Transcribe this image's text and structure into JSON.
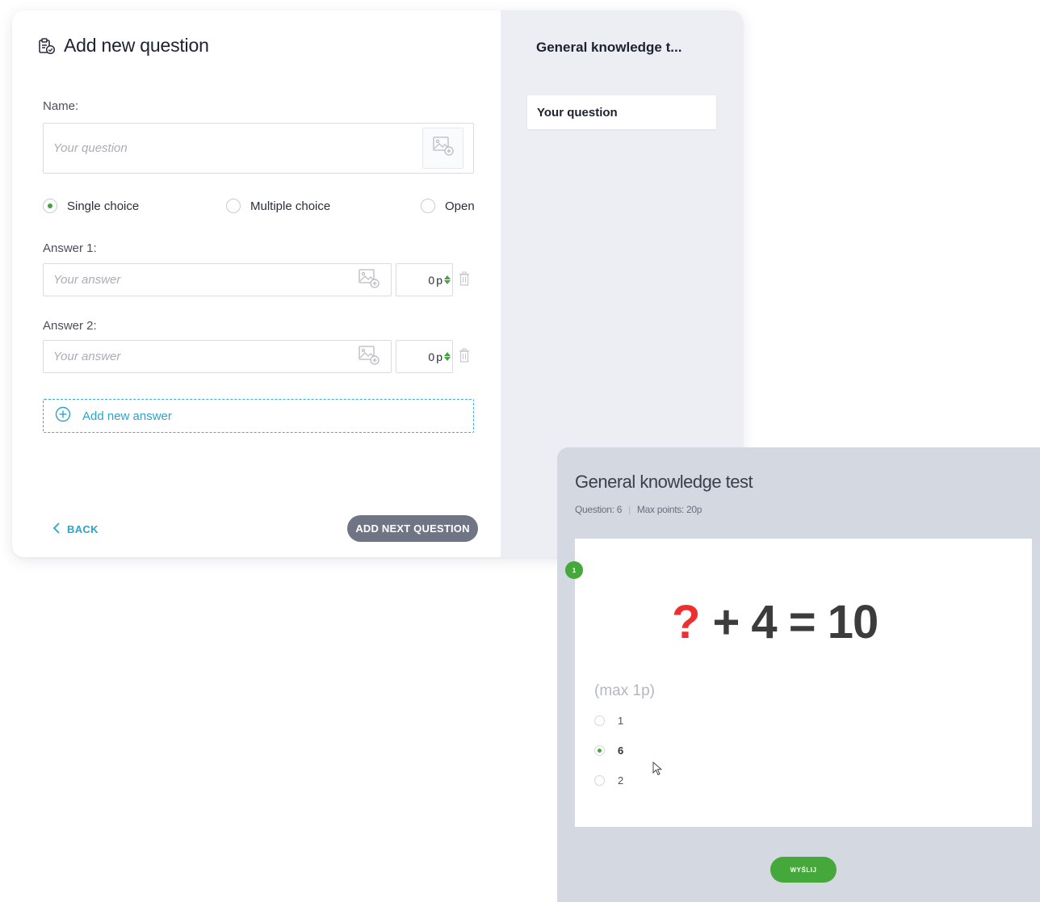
{
  "editor": {
    "title": "Add new question",
    "name_label": "Name:",
    "question_placeholder": "Your question",
    "question_types": [
      {
        "label": "Single choice",
        "selected": true
      },
      {
        "label": "Multiple choice",
        "selected": false
      },
      {
        "label": "Open",
        "selected": false
      }
    ],
    "answers": [
      {
        "label": "Answer 1:",
        "placeholder": "Your answer",
        "points": "0",
        "unit": "p"
      },
      {
        "label": "Answer 2:",
        "placeholder": "Your answer",
        "points": "0",
        "unit": "p"
      }
    ],
    "add_answer_label": "Add new answer",
    "back_label": "BACK",
    "next_label": "ADD NEXT QUESTION"
  },
  "sidebar": {
    "title": "General knowledge t...",
    "items": [
      {
        "label": "Your question"
      }
    ]
  },
  "preview": {
    "title": "General knowledge test",
    "question_count": "Question: 6",
    "max_points": "Max points: 20p",
    "badge": "1",
    "equation_mark": "?",
    "equation_rest": "+ 4 = 10",
    "max_label": "(max 1p)",
    "options": [
      {
        "label": "1",
        "selected": false
      },
      {
        "label": "6",
        "selected": true
      },
      {
        "label": "2",
        "selected": false
      }
    ],
    "send_label": "WYŚLIJ"
  },
  "colors": {
    "accent_green": "#43a33d",
    "accent_blue": "#2aa4cf",
    "button_gray": "#6f7584",
    "sidebar_bg": "#eceef3",
    "preview_bg": "#d3d8e1"
  },
  "icons": [
    "clipboard-check-icon",
    "add-image-icon",
    "trash-icon",
    "plus-circle-icon",
    "chevron-left-icon",
    "mouse-cursor-icon"
  ]
}
